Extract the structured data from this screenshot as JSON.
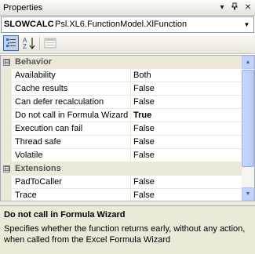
{
  "window": {
    "title": "Properties"
  },
  "object_selector": {
    "name": "SLOWCALC",
    "type": "Psl.XL6.FunctionModel.XlFunction"
  },
  "toolbar": {
    "categorized_icon": "categorized-icon",
    "alphabetical_icon": "alphabetical-icon",
    "property_pages_icon": "property-pages-icon",
    "categorized_pressed": true
  },
  "grid": {
    "categories": [
      {
        "label": "Behavior",
        "expander": "⊟",
        "properties": [
          {
            "name": "Availability",
            "value": "Both",
            "bold": false
          },
          {
            "name": "Cache results",
            "value": "False",
            "bold": false
          },
          {
            "name": "Can defer recalculation",
            "value": "False",
            "bold": false
          },
          {
            "name": "Do not call in Formula Wizard",
            "value": "True",
            "bold": true
          },
          {
            "name": "Execution can fail",
            "value": "False",
            "bold": false
          },
          {
            "name": "Thread safe",
            "value": "False",
            "bold": false
          },
          {
            "name": "Volatile",
            "value": "False",
            "bold": false
          }
        ]
      },
      {
        "label": "Extensions",
        "expander": "⊟",
        "properties": [
          {
            "name": "PadToCaller",
            "value": "False",
            "bold": false
          },
          {
            "name": "Trace",
            "value": "False",
            "bold": false
          }
        ]
      }
    ]
  },
  "description": {
    "title": "Do not call in Formula Wizard",
    "text": "Specifies whether the function returns early, without any action, when called from the Excel Formula Wizard"
  },
  "colors": {
    "panel_bg": "#ece9d8",
    "border": "#a5acb5",
    "selection_border": "#316ac5"
  }
}
